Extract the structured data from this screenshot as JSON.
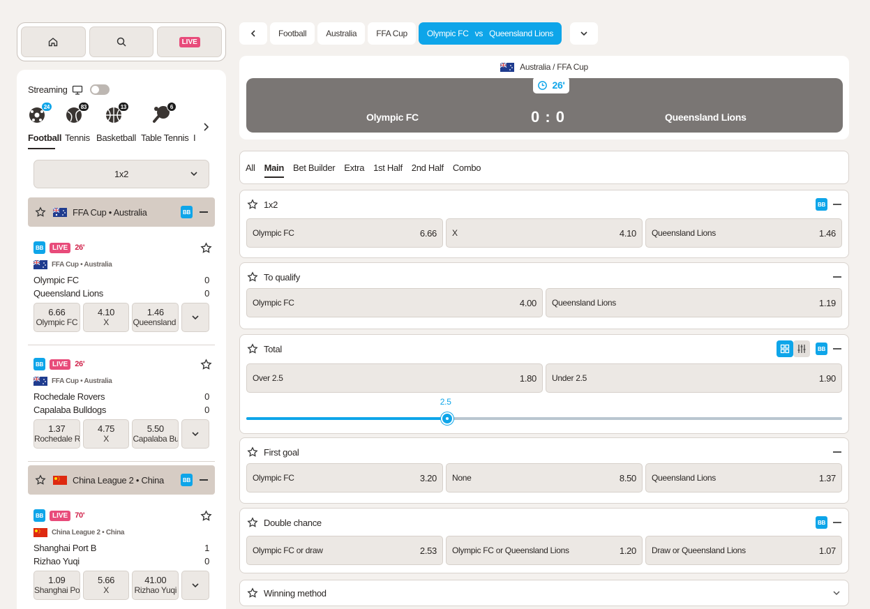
{
  "topnav": {
    "live_label": "LIVE"
  },
  "sidebar": {
    "streaming_label": "Streaming",
    "sports": [
      {
        "label": "Football",
        "count": "24"
      },
      {
        "label": "Tennis",
        "count": "83"
      },
      {
        "label": "Basketball",
        "count": "13"
      },
      {
        "label": "Table Tennis",
        "count": "6"
      },
      {
        "label": "I"
      }
    ],
    "market_select": "1x2",
    "leagues": [
      {
        "name": "FFA Cup • Australia",
        "bb": "BB"
      },
      {
        "name": "China League 2 • China",
        "bb": "BB"
      }
    ],
    "matches": [
      {
        "bb": "BB",
        "live": "LIVE",
        "time": "26'",
        "league": "FFA Cup • Australia",
        "home": "Olympic FC",
        "home_score": "0",
        "away": "Queensland Lions",
        "away_score": "0",
        "odds": [
          {
            "v": "6.66",
            "n": "Olympic FC"
          },
          {
            "v": "4.10",
            "n": "X"
          },
          {
            "v": "1.46",
            "n": "Queensland Lions"
          }
        ]
      },
      {
        "bb": "BB",
        "live": "LIVE",
        "time": "26'",
        "league": "FFA Cup • Australia",
        "home": "Rochedale Rovers",
        "home_score": "0",
        "away": "Capalaba Bulldogs",
        "away_score": "0",
        "odds": [
          {
            "v": "1.37",
            "n": "Rochedale Rovers"
          },
          {
            "v": "4.75",
            "n": "X"
          },
          {
            "v": "5.50",
            "n": "Capalaba Bulldogs"
          }
        ]
      },
      {
        "bb": "BB",
        "live": "LIVE",
        "time": "70'",
        "league": "China League 2 • China",
        "home": "Shanghai Port B",
        "home_score": "1",
        "away": "Rizhao Yuqi",
        "away_score": "0",
        "odds": [
          {
            "v": "1.09",
            "n": "Shanghai Port B"
          },
          {
            "v": "5.66",
            "n": "X"
          },
          {
            "v": "41.00",
            "n": "Rizhao Yuqi"
          }
        ]
      }
    ]
  },
  "breadcrumbs": [
    "Football",
    "Australia",
    "FFA Cup",
    "Olympic FC   vs   Queensland Lions"
  ],
  "scoreboard": {
    "league": "Australia / FFA Cup",
    "time": "26'",
    "home": "Olympic FC",
    "away": "Queensland Lions",
    "score": "0 : 0"
  },
  "tabs": [
    "All",
    "Main",
    "Bet Builder",
    "Extra",
    "1st Half",
    "2nd Half",
    "Combo"
  ],
  "markets": {
    "m1x2": {
      "title": "1x2",
      "bb": "BB",
      "sel": [
        {
          "n": "Olympic FC",
          "o": "6.66"
        },
        {
          "n": "X",
          "o": "4.10"
        },
        {
          "n": "Queensland Lions",
          "o": "1.46"
        }
      ]
    },
    "qualify": {
      "title": "To qualify",
      "sel": [
        {
          "n": "Olympic FC",
          "o": "4.00"
        },
        {
          "n": "Queensland Lions",
          "o": "1.19"
        }
      ]
    },
    "total": {
      "title": "Total",
      "bb": "BB",
      "sel": [
        {
          "n": "Over 2.5",
          "o": "1.80"
        },
        {
          "n": "Under 2.5",
          "o": "1.90"
        }
      ],
      "line_value": "2.5",
      "line_fraction": 0.337
    },
    "first_goal": {
      "title": "First goal",
      "sel": [
        {
          "n": "Olympic FC",
          "o": "3.20"
        },
        {
          "n": "None",
          "o": "8.50"
        },
        {
          "n": "Queensland Lions",
          "o": "1.37"
        }
      ]
    },
    "double_chance": {
      "title": "Double chance",
      "bb": "BB",
      "sel": [
        {
          "n": "Olympic FC or draw",
          "o": "2.53"
        },
        {
          "n": "Olympic FC or Queensland Lions",
          "o": "1.20"
        },
        {
          "n": "Draw or Queensland Lions",
          "o": "1.07"
        }
      ]
    },
    "winning_method": {
      "title": "Winning method"
    }
  },
  "colors": {
    "accent": "#0ea5e9",
    "live": "#e84b7a",
    "score_bar": "#7a7674"
  }
}
